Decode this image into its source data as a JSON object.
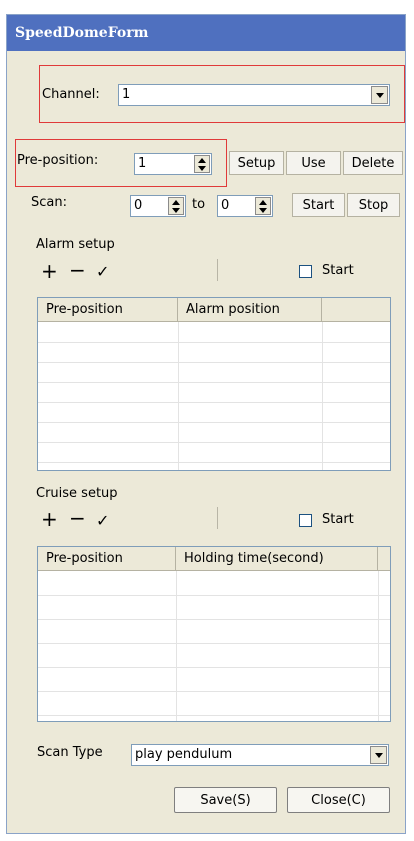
{
  "window": {
    "title": "SpeedDomeForm"
  },
  "channel": {
    "label": "Channel:",
    "value": "1"
  },
  "preposition": {
    "label": "Pre-position:",
    "value": "1",
    "setup_label": "Setup",
    "use_label": "Use",
    "delete_label": "Delete"
  },
  "scan": {
    "label": "Scan:",
    "from_value": "0",
    "to_label": "to",
    "to_value": "0",
    "start_label": "Start",
    "stop_label": "Stop"
  },
  "alarm": {
    "title": "Alarm setup",
    "start_label": "Start",
    "columns": [
      "Pre-position",
      "Alarm position"
    ]
  },
  "cruise": {
    "title": "Cruise setup",
    "start_label": "Start",
    "columns": [
      "Pre-position",
      "Holding time(second)"
    ]
  },
  "scan_type": {
    "label": "Scan Type",
    "value": "play pendulum"
  },
  "footer": {
    "save_label": "Save(S)",
    "close_label": "Close(C)"
  },
  "icons": {
    "add": "plus-icon",
    "remove": "minus-icon",
    "confirm": "check-icon"
  },
  "colors": {
    "title_bar": "#4f70bf",
    "highlight_box": "#e03a3a",
    "window_bg": "#ece9d8"
  }
}
